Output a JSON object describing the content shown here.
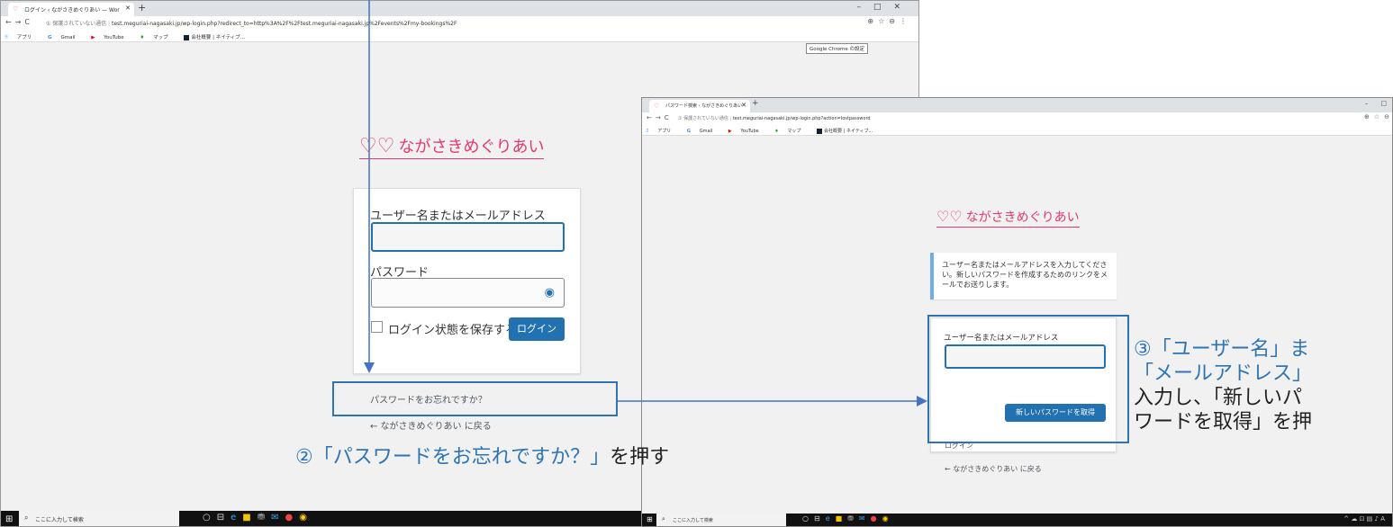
{
  "window1": {
    "tab_title": "ログイン ‹ ながさきめぐりあい — Wor",
    "url_insecure": "① 保護されていない通信",
    "url": "test.meguriai-nagasaki.jp/wp-login.php?redirect_to=http%3A%2F%2Ftest.meguriai-nagasaki.jp%2Fevents%2Fmy-bookings%2F",
    "bookmarks": [
      "アプリ",
      "Gmail",
      "YouTube",
      "マップ",
      "会社概要 | ネイティブ..."
    ],
    "tooltip": "Google Chrome の設定",
    "logo_text": "ながさきめぐりあい",
    "username_label": "ユーザー名またはメールアドレス",
    "password_label": "パスワード",
    "remember_label": "ログイン状態を保存する",
    "login_button": "ログイン",
    "lost_password_link": "パスワードをお忘れですか？",
    "back_link": "← ながさきめぐりあい に戻る",
    "taskbar_search": "ここに入力して検索"
  },
  "window2": {
    "tab_title": "パスワード検索 ‹ ながさきめぐりあい",
    "url_insecure": "① 保護されていない通信",
    "url": "test.meguriai-nagasaki.jp/wp-login.php?action=lostpassword",
    "bookmarks": [
      "アプリ",
      "Gmail",
      "YouTube",
      "マップ",
      "会社概要 | ネイティブ..."
    ],
    "logo_text": "ながさきめぐりあい",
    "notice": "ユーザー名またはメールアドレスを入力してください。新しいパスワードを作成するためのリンクをメールでお送りします。",
    "username_label": "ユーザー名またはメールアドレス",
    "get_password_button": "新しいパスワードを取得",
    "login_link": "ログイン",
    "back_link": "← ながさきめぐりあい に戻る",
    "taskbar_search": "ここに入力して検索"
  },
  "annotations": {
    "step2_blue": "②「パスワードをお忘れですか？」",
    "step2_black": "を押す",
    "step3_line1_blue": "③「ユーザー名」ま",
    "step3_line2_blue": "「メールアドレス」",
    "step3_line3": "入力し、「新しいパ",
    "step3_line4": "ワードを取得」を押"
  },
  "colors": {
    "accent": "#2271b1",
    "logo": "#e43a6b",
    "annotation": "#2e74b5"
  }
}
